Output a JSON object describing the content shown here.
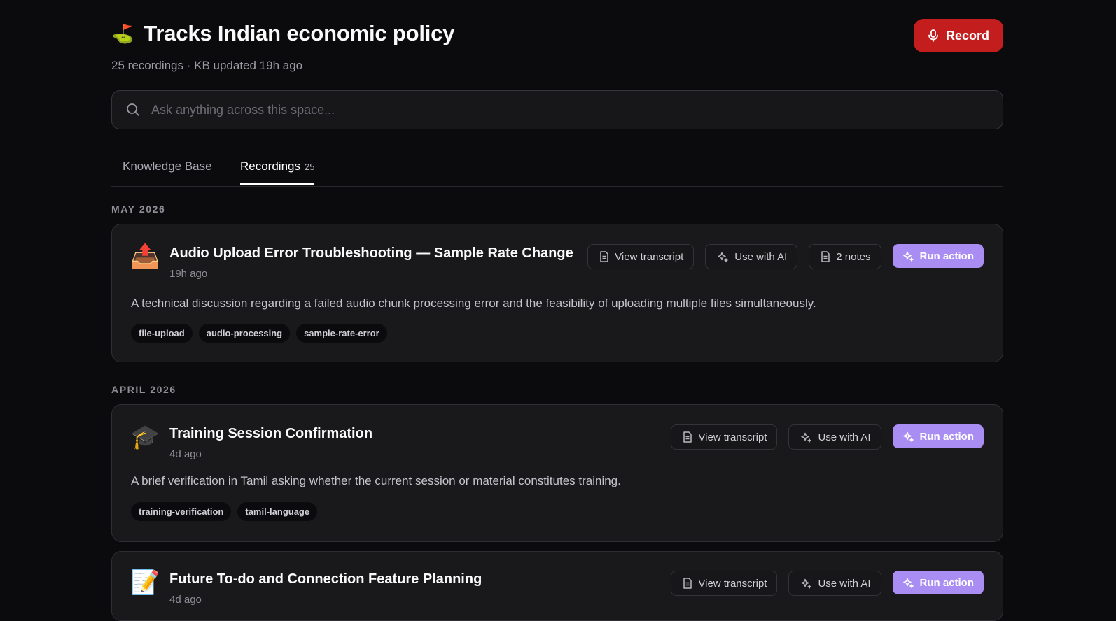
{
  "space": {
    "emoji": "⛳",
    "title": "Tracks Indian economic policy",
    "subtitle": "25 recordings · KB updated 19h ago",
    "record_label": "Record"
  },
  "search": {
    "placeholder": "Ask anything across this space..."
  },
  "tabs": [
    {
      "label": "Knowledge Base"
    },
    {
      "label": "Recordings",
      "count": "25",
      "active": true
    }
  ],
  "groups": [
    {
      "month": "MAY 2026",
      "recordings": [
        {
          "emoji": "📤",
          "title": "Audio Upload Error Troubleshooting — Sample Rate Change",
          "date": "19h ago",
          "description": "A technical discussion regarding a failed audio chunk processing error and the feasibility of uploading multiple files simultaneously.",
          "tags": [
            "file-upload",
            "audio-processing",
            "sample-rate-error"
          ],
          "view_transcript": "View transcript",
          "use_ai": "Use with AI",
          "notes": "2 notes",
          "run_action": "Run action"
        }
      ]
    },
    {
      "month": "APRIL 2026",
      "recordings": [
        {
          "emoji": "🎓",
          "title": "Training Session Confirmation",
          "date": "4d ago",
          "description": "A brief verification in Tamil asking whether the current session or material constitutes training.",
          "tags": [
            "training-verification",
            "tamil-language"
          ],
          "view_transcript": "View transcript",
          "use_ai": "Use with AI",
          "run_action": "Run action"
        },
        {
          "emoji": "📝",
          "title": "Future To-do and Connection Feature Planning",
          "date": "4d ago",
          "view_transcript": "View transcript",
          "use_ai": "Use with AI",
          "run_action": "Run action"
        }
      ]
    }
  ],
  "colors": {
    "record": "#c41d1d",
    "accent": "#a98df2",
    "background": "#0b0b0d",
    "card": "#19191c"
  }
}
